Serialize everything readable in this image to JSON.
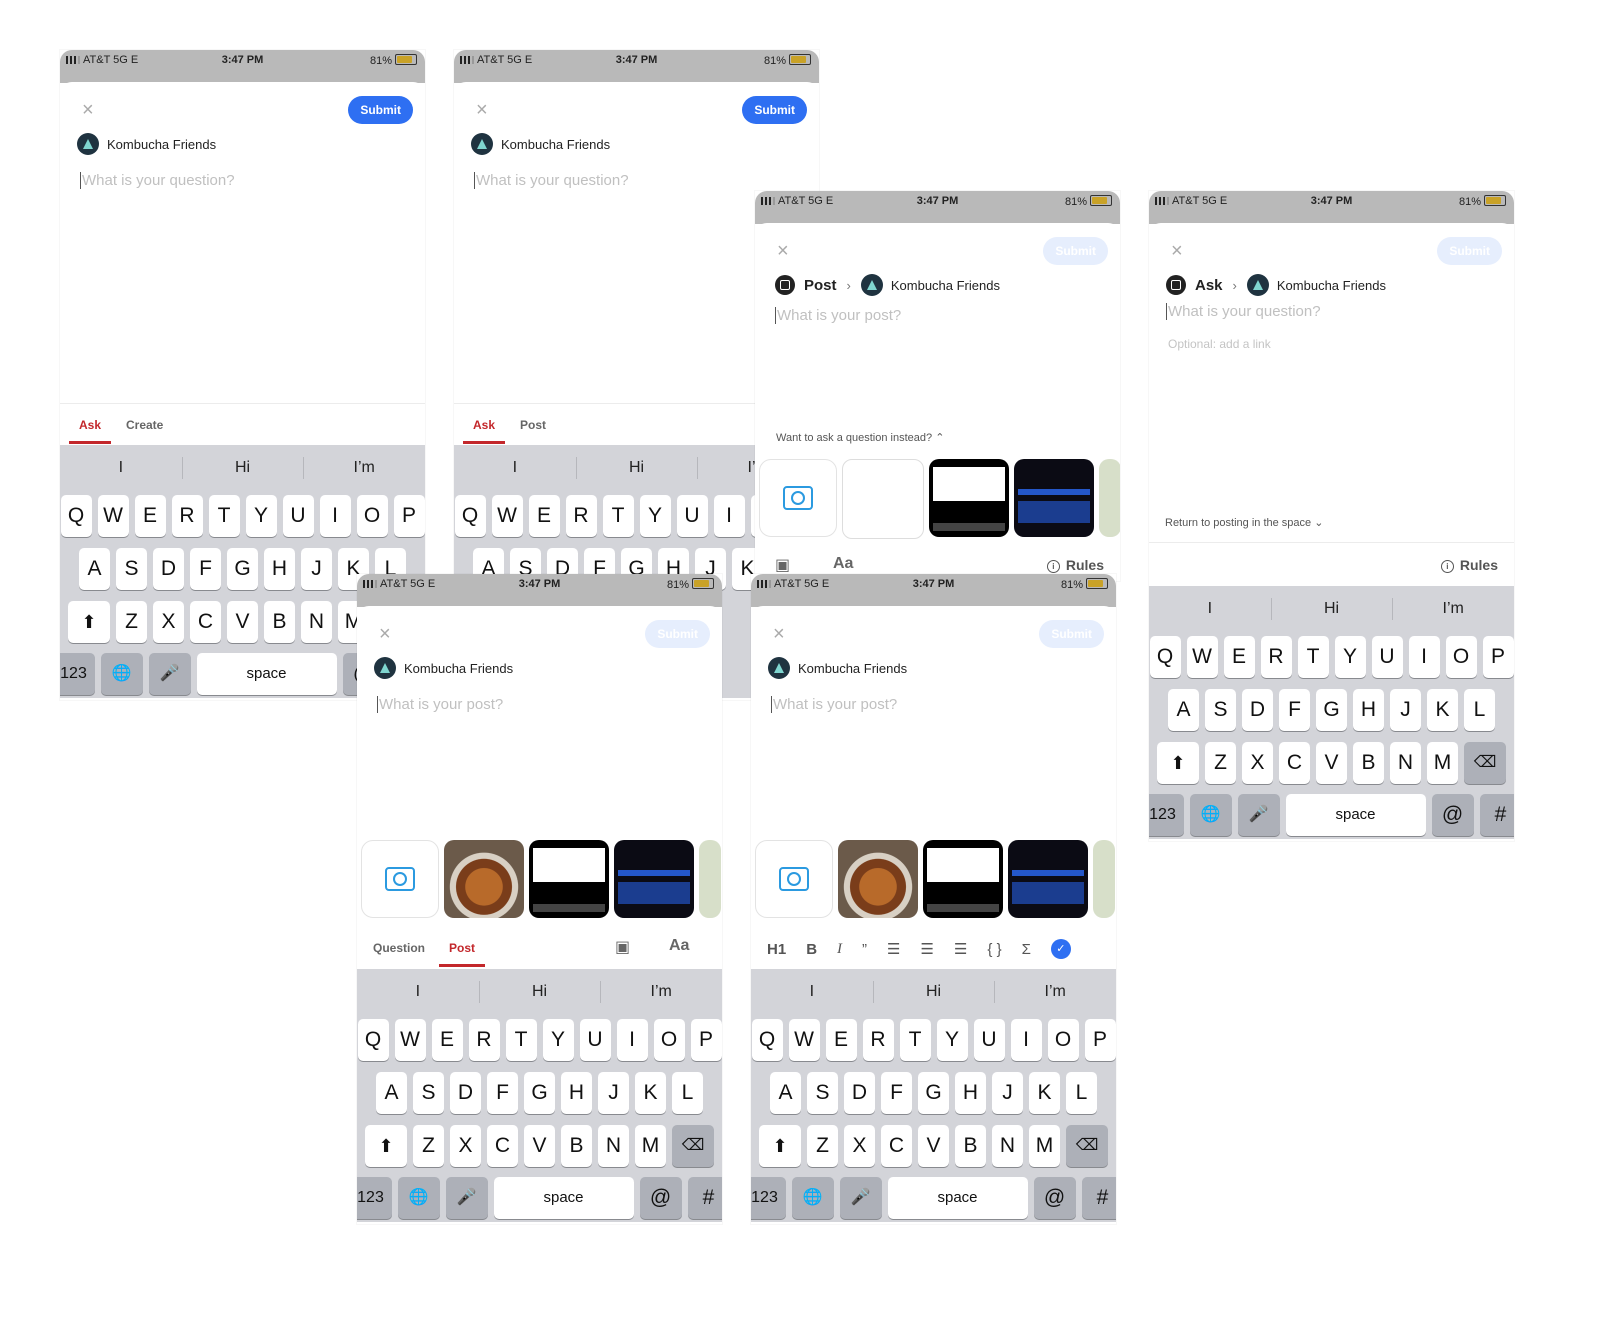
{
  "status": {
    "carrier": "AT&T  5G E",
    "time": "3:47 PM",
    "battery": "81%"
  },
  "space_name": "Kombucha Friends",
  "submit_label": "Submit",
  "close_symbol": "×",
  "placeholders": {
    "question": "What is your question?",
    "post": "What is your post?",
    "optional_link": "Optional: add a link"
  },
  "type_labels": {
    "post": "Post",
    "ask": "Ask"
  },
  "screens": {
    "s1": {
      "tabs": [
        "Ask",
        "Create"
      ]
    },
    "s2": {
      "tabs": [
        "Ask",
        "Post"
      ]
    },
    "s3": {
      "hint": "Want to ask a question instead? ⌃",
      "aa": "Aa",
      "rules": "Rules"
    },
    "s4": {
      "hint": "Return to posting in the space ⌄",
      "rules": "Rules"
    },
    "s5": {
      "tabs": [
        "Question",
        "Post"
      ],
      "aa": "Aa"
    },
    "s6": {
      "format": [
        "H1",
        "B",
        "I",
        "”",
        "☰",
        "☰",
        "☰",
        "{ }",
        "Σ",
        "✓"
      ]
    }
  },
  "keyboard": {
    "suggestions": [
      "I",
      "Hi",
      "I’m"
    ],
    "row1": [
      "Q",
      "W",
      "E",
      "R",
      "T",
      "Y",
      "U",
      "I",
      "O",
      "P"
    ],
    "row2": [
      "A",
      "S",
      "D",
      "F",
      "G",
      "H",
      "J",
      "K",
      "L"
    ],
    "row3": [
      "Z",
      "X",
      "C",
      "V",
      "B",
      "N",
      "M"
    ],
    "shift": "⬆",
    "backspace": "⌫",
    "num": "123",
    "globe": "🌐",
    "mic": "🎤",
    "space": "space",
    "at": "@",
    "hash": "#"
  },
  "icons": [
    "close-icon",
    "flask-icon",
    "camera-icon",
    "info-icon",
    "chevron-right-icon",
    "image-icon"
  ]
}
